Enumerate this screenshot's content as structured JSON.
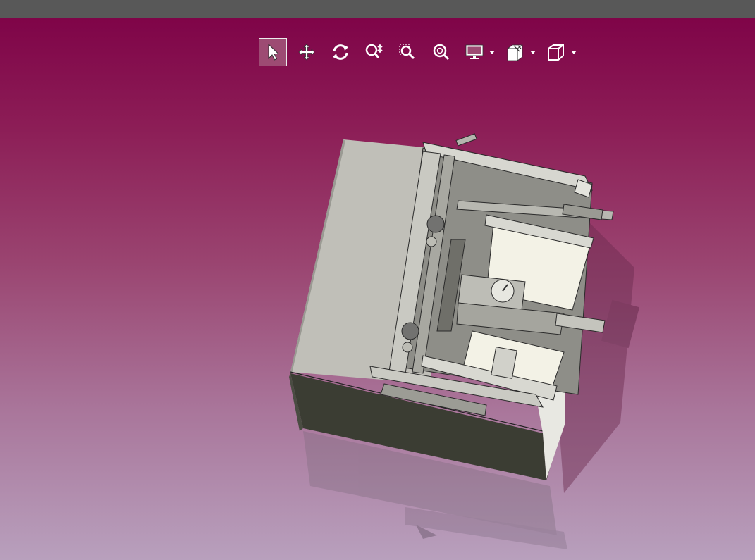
{
  "app": {
    "window_title": ""
  },
  "toolbar": {
    "tools": [
      {
        "name": "select",
        "icon": "select-arrow-icon",
        "active": true
      },
      {
        "name": "pan",
        "icon": "pan-move-icon",
        "active": false
      },
      {
        "name": "rotate",
        "icon": "rotate-icon",
        "active": false
      },
      {
        "name": "zoom",
        "icon": "zoom-icon",
        "active": false
      },
      {
        "name": "zoom-box",
        "icon": "zoom-box-icon",
        "active": false
      },
      {
        "name": "zoom-fit",
        "icon": "zoom-fit-icon",
        "active": false
      },
      {
        "name": "display",
        "icon": "display-monitor-icon",
        "has_dropdown": true
      },
      {
        "name": "section",
        "icon": "section-cut-icon",
        "has_dropdown": true
      },
      {
        "name": "view-orientation",
        "icon": "cube-view-icon",
        "has_dropdown": true
      }
    ]
  },
  "colors": {
    "toolbar_active_bg": "#9d4b73",
    "icon_color": "#ffffff",
    "titlebar": "#585858",
    "background_top": "#7f0448",
    "background_bottom": "#b8a0bd",
    "model_face_light": "#c0bfb8",
    "model_face_dark": "#3b3d33"
  }
}
